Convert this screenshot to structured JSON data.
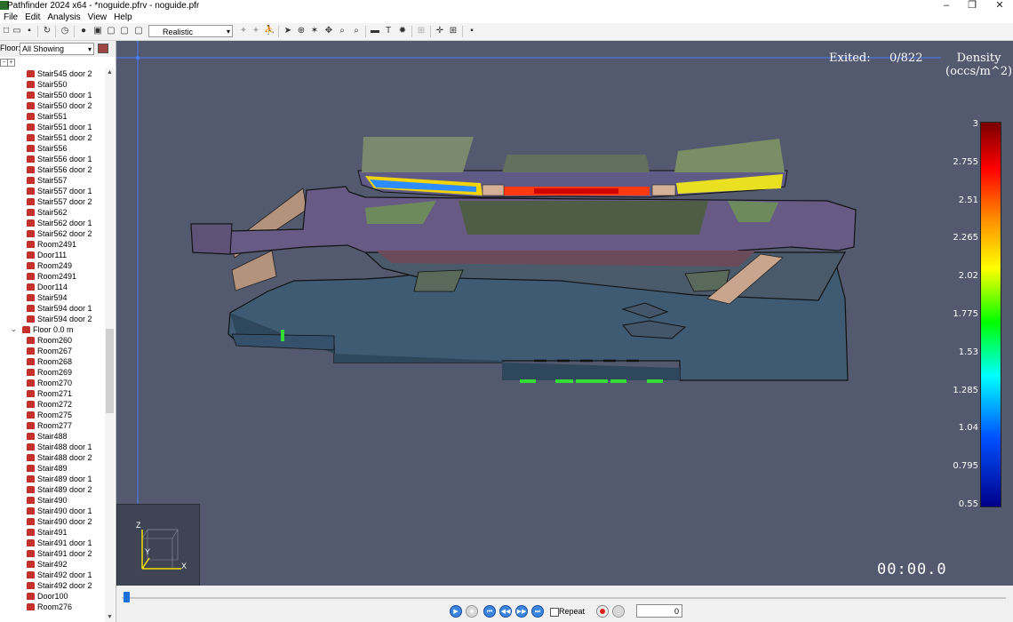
{
  "window": {
    "title": "Pathfinder 2024 x64 - *noguide.pfrv - noguide.pfr",
    "minimize": "–",
    "restore": "❐",
    "close": "✕"
  },
  "menu": [
    "File",
    "Edit",
    "Analysis",
    "View",
    "Help"
  ],
  "toolbar": {
    "render_mode": "Realistic"
  },
  "floor_selector": {
    "label": "Floor:",
    "value": "All Showing"
  },
  "tree": {
    "items": [
      "Stair545 door 2",
      "Stair550",
      "Stair550 door 1",
      "Stair550 door 2",
      "Stair551",
      "Stair551 door 1",
      "Stair551 door 2",
      "Stair556",
      "Stair556 door 1",
      "Stair556 door 2",
      "Stair557",
      "Stair557 door 1",
      "Stair557 door 2",
      "Stair562",
      "Stair562 door 1",
      "Stair562 door 2",
      "Room2491",
      "Door111",
      "Room249",
      "Room2491",
      "Door114",
      "Stair594",
      "Stair594 door 1",
      "Stair594 door 2",
      "Floor 0.0 m",
      "Room260",
      "Room267",
      "Room268",
      "Room269",
      "Room270",
      "Room271",
      "Room272",
      "Room275",
      "Room277",
      "Stair488",
      "Stair488 door 1",
      "Stair488 door 2",
      "Stair489",
      "Stair489 door 1",
      "Stair489 door 2",
      "Stair490",
      "Stair490 door 1",
      "Stair490 door 2",
      "Stair491",
      "Stair491 door 1",
      "Stair491 door 2",
      "Stair492",
      "Stair492 door 1",
      "Stair492 door 2",
      "Door100",
      "Room276"
    ]
  },
  "viewport": {
    "exited_label": "Exited:",
    "exited_value": "0/822",
    "density_title_line1": "Density",
    "density_title_line2": "(occs/m^2)",
    "colorbar_ticks": [
      "3",
      "2.755",
      "2.51",
      "2.265",
      "2.02",
      "1.775",
      "1.53",
      "1.285",
      "1.04",
      "0.795",
      "0.55"
    ],
    "timer": "00:00.0",
    "axis_labels": {
      "z": "Z",
      "y": "Y",
      "x": "X"
    }
  },
  "playback": {
    "repeat_label": "Repeat",
    "frame_value": "0",
    "progress": 0
  }
}
